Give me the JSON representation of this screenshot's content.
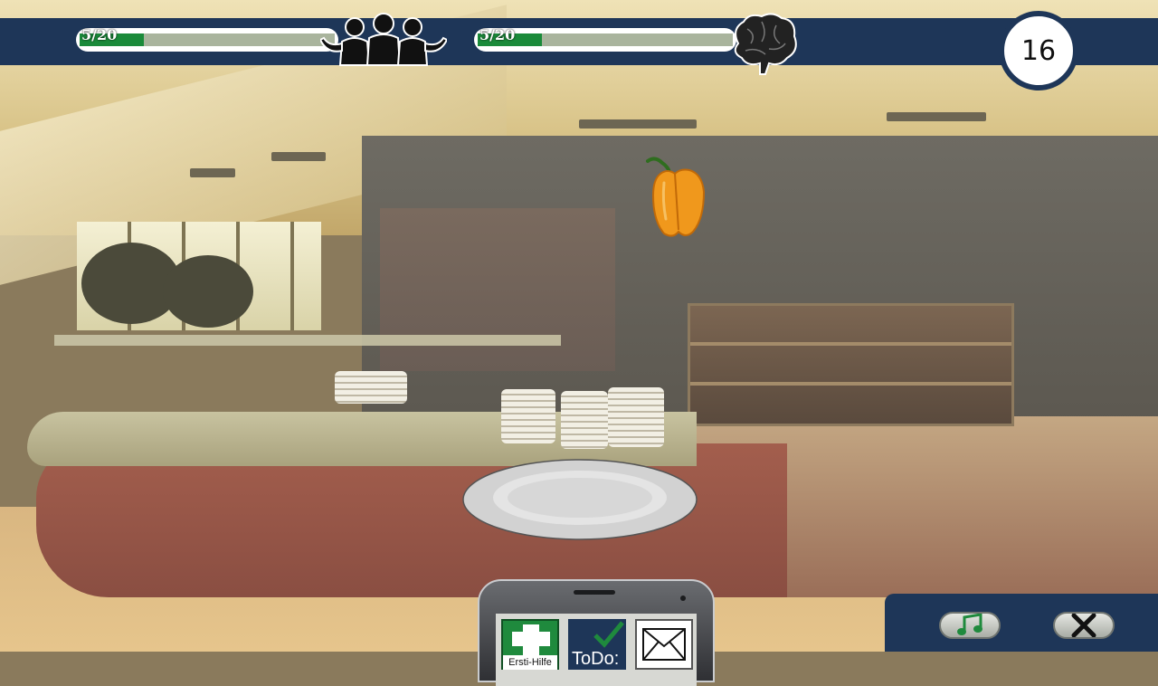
{
  "hud": {
    "social_bar": {
      "label": "5/20",
      "value": 5,
      "max": 20,
      "icon": "group-icon"
    },
    "knowledge_bar": {
      "label": "5/20",
      "value": 5,
      "max": 20,
      "icon": "brain-icon"
    },
    "timer": "16"
  },
  "item": {
    "name": "yellow-pepper",
    "icon": "pepper-icon"
  },
  "phone": {
    "apps": [
      {
        "id": "first-aid",
        "label": "Ersti-Hilfe",
        "icon": "first-aid-icon"
      },
      {
        "id": "todo",
        "label": "ToDo:",
        "icon": "checkmark-icon"
      },
      {
        "id": "mail",
        "label": "",
        "icon": "envelope-icon"
      }
    ]
  },
  "controls": {
    "music": {
      "icon": "music-note-icon"
    },
    "close": {
      "icon": "close-icon"
    }
  },
  "colors": {
    "hud_bg": "#1e3658",
    "bar_fill": "#1a8a3a",
    "bar_track": "#a9b49d"
  }
}
